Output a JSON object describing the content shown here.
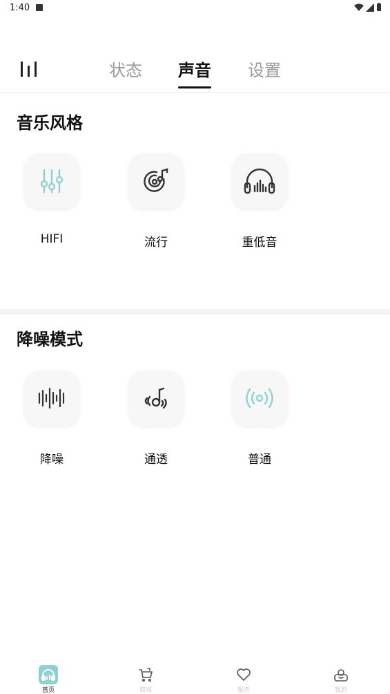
{
  "status_bar": {
    "time": "1:40"
  },
  "tabs": [
    {
      "label": "状态",
      "active": false
    },
    {
      "label": "声音",
      "active": true
    },
    {
      "label": "设置",
      "active": false
    }
  ],
  "sections": [
    {
      "title": "音乐风格",
      "items": [
        {
          "label": "HIFI",
          "icon": "equalizer-sliders-icon",
          "selected": true
        },
        {
          "label": "流行",
          "icon": "vinyl-music-note-icon",
          "selected": false
        },
        {
          "label": "重低音",
          "icon": "headphones-bass-icon",
          "selected": false
        }
      ]
    },
    {
      "title": "降噪模式",
      "items": [
        {
          "label": "降噪",
          "icon": "sound-wave-icon",
          "selected": false
        },
        {
          "label": "通透",
          "icon": "ambient-sound-icon",
          "selected": false
        },
        {
          "label": "普通",
          "icon": "broadcast-icon",
          "selected": true
        }
      ]
    }
  ],
  "bottom_nav": [
    {
      "label": "首页",
      "icon": "home-headphones-icon",
      "active": true
    },
    {
      "label": "商城",
      "icon": "cart-icon",
      "active": false
    },
    {
      "label": "服务",
      "icon": "heart-icon",
      "active": false
    },
    {
      "label": "我的",
      "icon": "profile-icon",
      "active": false
    }
  ],
  "colors": {
    "accent": "#8fd0d3",
    "icon_dark": "#333333",
    "tab_inactive": "#9a9a9a"
  }
}
